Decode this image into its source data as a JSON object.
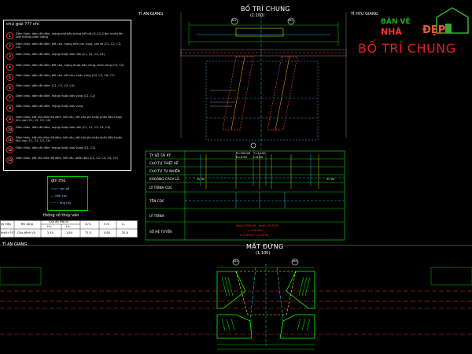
{
  "drawing": {
    "plan_title": "BỐ TRÍ CHUNG",
    "plan_scale": "(1:100)",
    "elev_title": "MẶT ĐỨNG",
    "elev_scale": "(1:100)",
    "left_side": "TỈ AN GIANG",
    "right_side": "TỈ HYU GIANG",
    "left_side_bottom": "TỈ AN GIANG"
  },
  "notes": {
    "header": "chú giải ??? chỉ",
    "items": [
      {
        "num": "1",
        "text": "Dầm khẩu, dầm đỡ dầm, mang phố dầu móng kết cấu D.2.5.2.8m nhiều lên lướt không phần tường"
      },
      {
        "num": "2",
        "text": "Dầm khẩu, dầm đỡ dầm, kết cấu, mạng trên các vùng, sàn kê (C1, C2, C3, C4)"
      },
      {
        "num": "3",
        "text": "Dầm khẩu, dầm đỡ dầm, mạng thuộc bản nền (C1, C2, C3, C4)"
      },
      {
        "num": "4",
        "text": "Dầm khẩu, dầm đỡ dầm, kết cấu, mạng thuộc bản vùng, chân cũng (C4, C5)"
      },
      {
        "num": "5",
        "text": "Dầm khẩu, dầm đỡ dầm, kết cấu, kết cấu, chân cũng (C4, C5, C6, C7)"
      },
      {
        "num": "6",
        "text": "Dầm khẩu, dầm đỡ dầm, (C1, C2, C3, C4)"
      },
      {
        "num": "7",
        "text": "Dầm khẩu, dầm đỡ dầm, mạng thuộc bản vùng (C1, C2)"
      },
      {
        "num": "8",
        "text": "Dầm khẩu, dầm đỡ dầm, mạng thuộc bản vùng"
      },
      {
        "num": "9",
        "text": "Dầm khẩu, kết cấu dầm đỡ dầm, kết cấu, kết cấu ghi nhận phần đầu thuộc khu vực (C1, C2, C3, C4)"
      },
      {
        "num": "10",
        "text": "Dầm khẩu, dầm đỡ dầm, mạng thuộc bản nền (C1, C2, C3, C4, C5)"
      },
      {
        "num": "11",
        "text": "Dầm khẩu, kết cấu dầm đỡ dầm, kết cấu, kết cấu ghi nhận phần đầu thuộc khu vực (C1, C2, C3, C4)"
      },
      {
        "num": "12",
        "text": "Dầm khẩu, dầm đỡ dầm, mạng thuộc bản vùng (C1, C2)"
      },
      {
        "num": "13",
        "text": "Dầm khẩu, kết cấu dầm đỡ dầm, kết cấu, phần đầu (C1, C2, C3, C4, C5)"
      }
    ]
  },
  "legend": {
    "title": "ghi chú",
    "items": [
      "=== cọc gỗ",
      "--- bản cọc",
      "~~~ ống tuy"
    ]
  },
  "hydro_table": {
    "title": "thông số thủy văn",
    "headers": [
      "Ký hiệu",
      "Tên sông",
      "Cao độ MNCN",
      "H₁₀",
      "H₅₀",
      "Q₁%",
      "V₁%",
      "L₀"
    ],
    "row": [
      "Km0+707",
      "Cầu Kênh VII",
      "2,40",
      "1,84",
      "71,5",
      "0,85",
      "25,8"
    ]
  },
  "profile_rows": [
    "TỶ SỐ TẠI KỲ",
    "CAO TỰ THIẾT KẾ",
    "CAO TỰ TỰ NHIÊN",
    "KHOẢNG CÁCH LẺ",
    "LÝ TRÌNH CỌC",
    "TÊN CỌC",
    "LÝ TRÌNH",
    "SỐ HỆ TUYẾN"
  ],
  "profile_info": [
    "R=250.00",
    "T=15.00",
    "D=0.00",
    "i=0.05"
  ],
  "profile_red": [
    "Km0+700.00 - Km0+723.00",
    "L=23.00m",
    "i=0.50% / i=0.50%"
  ],
  "profile_distances": [
    "22.00",
    "25.00"
  ],
  "markers": [
    "M1",
    "M2",
    "M3",
    "M4"
  ],
  "logo": {
    "line1": "BẢN VẼ",
    "line2": "NHÀ",
    "line3": "ĐẸP",
    "overlay": "BỐ TRÍ CHUNG"
  },
  "colors": {
    "background": "#000000",
    "structure": "#00ff00",
    "dimension": "#00ffff",
    "highlight": "#ffff00",
    "accent": "#ff3030"
  }
}
